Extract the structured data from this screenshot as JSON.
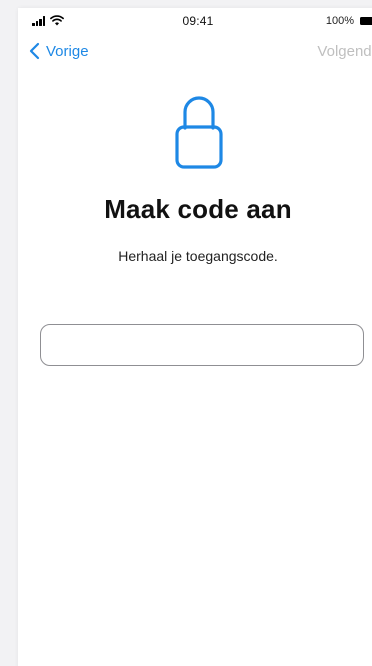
{
  "status_bar": {
    "time": "09:41",
    "battery_percent": "100%"
  },
  "nav": {
    "back_label": "Vorige",
    "next_label": "Volgende"
  },
  "main": {
    "title": "Maak code aan",
    "subtitle": "Herhaal je toegangscode.",
    "code_input_value": ""
  },
  "colors": {
    "accent": "#1e88e5",
    "disabled_text": "#bfbfbf",
    "input_border": "#8f8f93"
  },
  "icons": [
    "signal-icon",
    "wifi-icon",
    "battery-icon",
    "chevron-left-icon",
    "lock-icon"
  ]
}
